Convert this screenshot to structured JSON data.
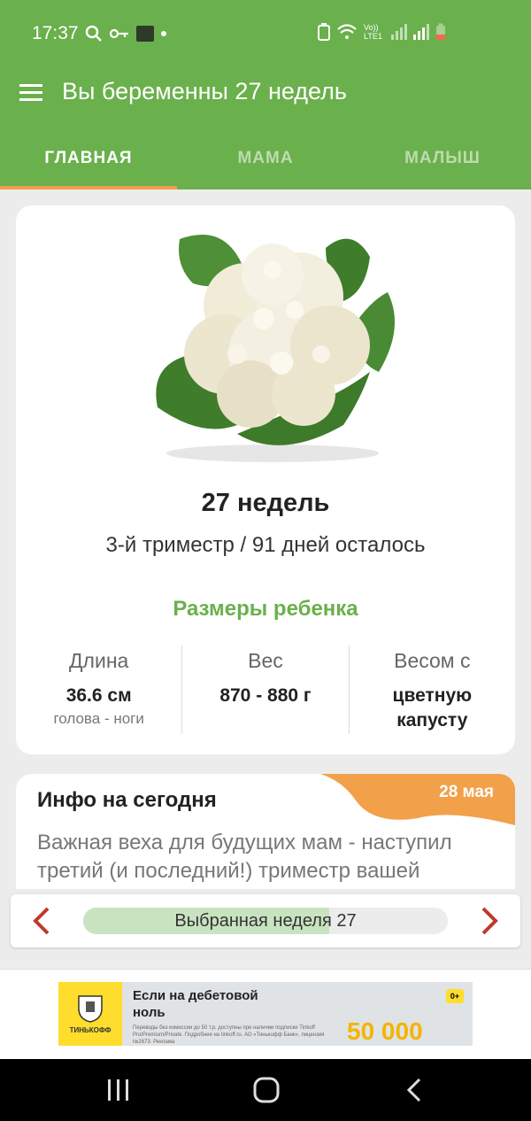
{
  "status_bar": {
    "time": "17:37",
    "network": "Vo)) LTE1"
  },
  "header": {
    "title": "Вы беременны 27 недель"
  },
  "tabs": [
    {
      "label": "ГЛАВНАЯ",
      "active": true
    },
    {
      "label": "МАМА",
      "active": false
    },
    {
      "label": "МАЛЫШ",
      "active": false
    }
  ],
  "colors": {
    "primary": "#6ab04c",
    "accent": "#f2a04a"
  },
  "summary": {
    "image_icon": "cauliflower-image",
    "weeks": "27 недель",
    "trimester": "3-й триместр / 91 дней осталось",
    "sizes_title": "Размеры ребенка",
    "stats": [
      {
        "label": "Длина",
        "value": "36.6 см",
        "sub": "голова - ноги"
      },
      {
        "label": "Вес",
        "value": "870 - 880 г",
        "sub": ""
      },
      {
        "label": "Весом с",
        "value": "цветную\nкапусту",
        "sub": ""
      }
    ]
  },
  "info": {
    "title": "Инфо на сегодня",
    "date": "28 мая",
    "text": "Важная веха для будущих мам - наступил третий (и последний!) триместр вашей беременности! С"
  },
  "week_selector": {
    "label": "Выбранная неделя 27",
    "progress": 0.675
  },
  "ad": {
    "brand": "ТИНЬКОФФ",
    "headline": "Если на дебетовой\nноль",
    "fine_print": "Переводы без комиссии до 50 т.р. доступны при наличии подписки Tinkoff Pro/Premium/Private. Подробнее на tinkoff.ru. АО «Тинькофф Банк», лицензия №2673. Реклама",
    "amount": "50 000",
    "age": "0+"
  }
}
